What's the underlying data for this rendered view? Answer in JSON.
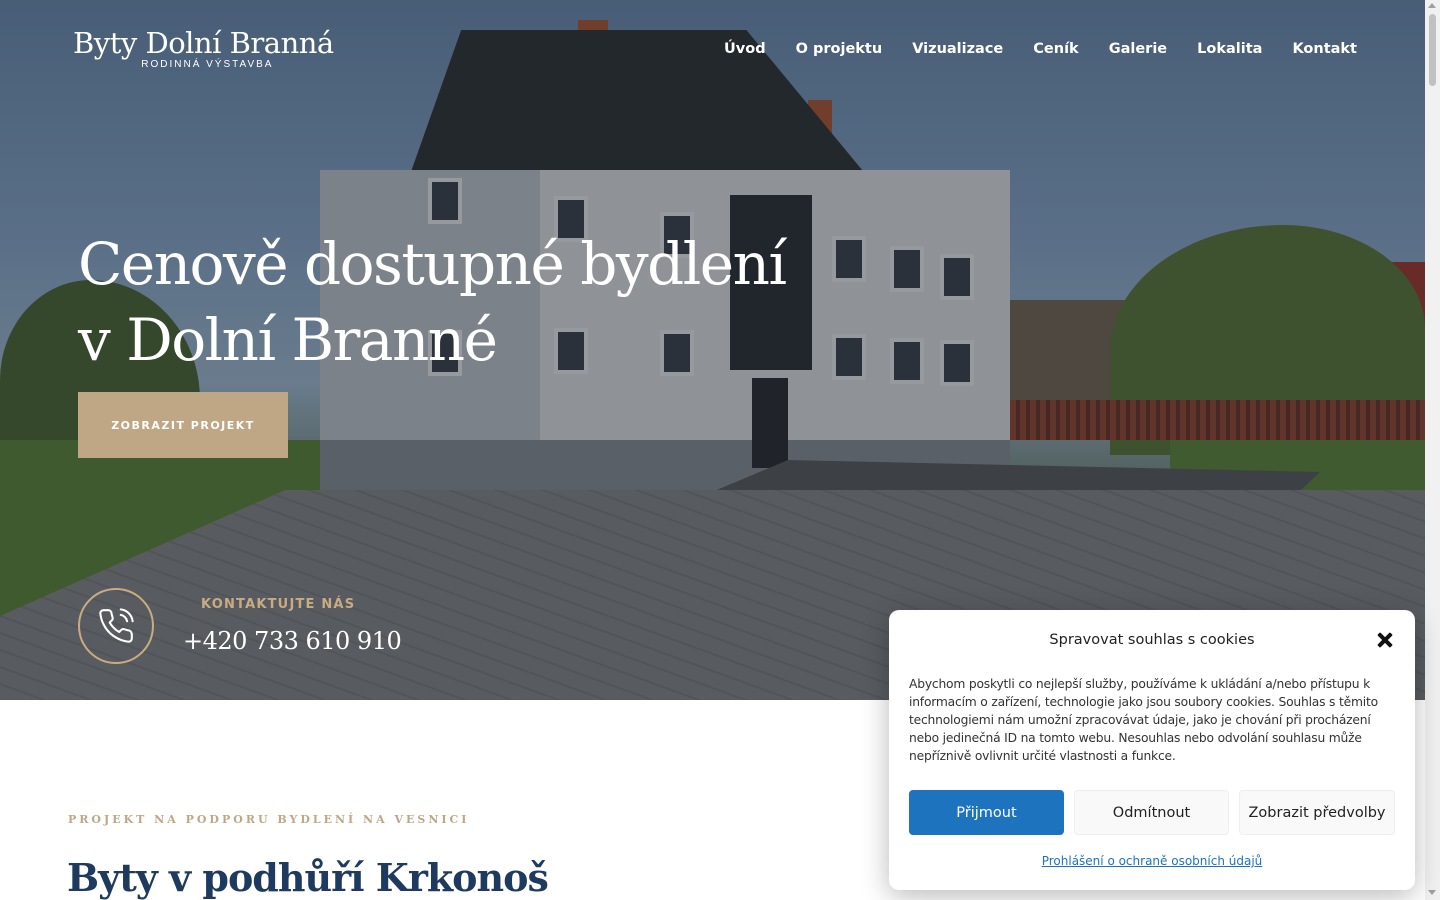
{
  "header": {
    "logo_title": "Byty Dolní Branná",
    "logo_subtitle": "RODINNÁ VÝSTAVBA",
    "nav": [
      "Úvod",
      "O projektu",
      "Vizualizace",
      "Ceník",
      "Galerie",
      "Lokalita",
      "Kontakt"
    ]
  },
  "hero": {
    "title_line1": "Cenově dostupné bydlení",
    "title_line2": "v Dolní Branné",
    "cta_label": "ZOBRAZIT PROJEKT",
    "contact_label": "KONTAKTUJTE NÁS",
    "contact_phone": "+420 733 610 910",
    "icon": "phone-icon"
  },
  "section": {
    "eyebrow": "PROJEKT NA PODPORU BYDLENÍ NA VESNICI",
    "title": "Byty v podhůří Krkonoš"
  },
  "cookie_dialog": {
    "title": "Spravovat souhlas s cookies",
    "text": "Abychom poskytli co nejlepší služby, používáme k ukládání a/nebo přístupu k informacím o zařízení, technologie jako jsou soubory cookies. Souhlas s těmito technologiemi nám umožní zpracovávat údaje, jako je chování při procházení nebo jedinečná ID na tomto webu. Nesouhlas nebo odvolání souhlasu může nepříznivě ovlivnit určité vlastnosti a funkce.",
    "accept_label": "Přijmout",
    "deny_label": "Odmítnout",
    "prefs_label": "Zobrazit předvolby",
    "privacy_link": "Prohlášení o ochraně osobních údajů"
  },
  "colors": {
    "accent_gold": "#bfa685",
    "heading_navy": "#1e3a5f",
    "button_blue": "#1e73be"
  }
}
